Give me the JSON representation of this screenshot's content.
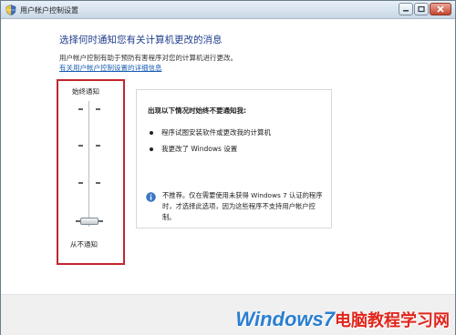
{
  "window": {
    "title": "用户帐户控制设置",
    "icons": [
      "uac-shield-icon",
      "minimize-icon",
      "maximize-icon",
      "close-icon"
    ]
  },
  "main": {
    "heading": "选择何时通知您有关计算机更改的消息",
    "description": "用户帐户控制有助于预防有害程序对您的计算机进行更改。",
    "link": "有关用户帐户控制设置的详细信息"
  },
  "slider": {
    "top_label": "始终通知",
    "bottom_label": "从不通知",
    "level": 0,
    "levels": 4
  },
  "info": {
    "title": "出现以下情况时始终不要通知我:",
    "bullets": [
      "程序试图安装软件或更改我的计算机",
      "我更改了 Windows 设置"
    ],
    "note": "不推荐。仅在需要使用未获得 Windows 7 认证的程序时，才选择此选项，因为这些程序不支持用户帐户控制。"
  },
  "watermark": {
    "en": "Windows7",
    "cn": "电脑教程学习网"
  },
  "colors": {
    "heading": "#1f3d8c",
    "link": "#1a5fb4",
    "highlight_border": "#c2262e",
    "watermark_en": "#2b7fd0",
    "watermark_cn": "#e1261c"
  }
}
